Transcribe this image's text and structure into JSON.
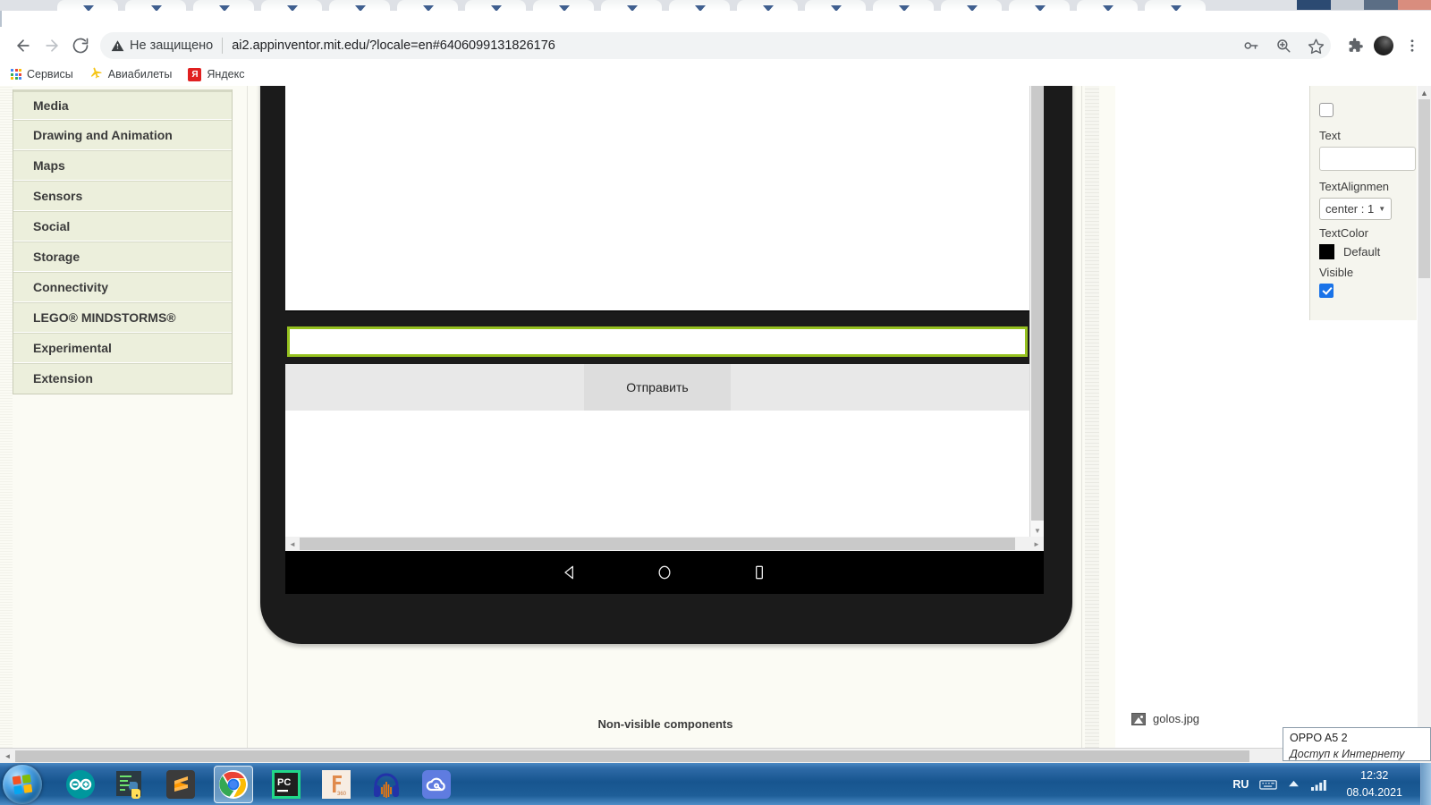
{
  "browser": {
    "nav": {
      "back": "back-arrow",
      "forward": "forward-arrow",
      "reload": "reload"
    },
    "omnibox": {
      "security_warning": "Не защищено",
      "url": "ai2.appinventor.mit.edu/?locale=en#6406099131826176"
    },
    "toolbar_icons": [
      "key-icon",
      "zoom-icon",
      "star-icon",
      "extensions-icon",
      "profile-avatar",
      "chrome-menu-icon"
    ],
    "bookmarks": [
      {
        "label": "Сервисы",
        "icon": "apps-grid-icon"
      },
      {
        "label": "Авиабилеты",
        "icon": "plane-icon"
      },
      {
        "label": "Яндекс",
        "icon": "yandex-icon"
      }
    ]
  },
  "palette": {
    "items": [
      {
        "label": "Media"
      },
      {
        "label": "Drawing and Animation"
      },
      {
        "label": "Maps"
      },
      {
        "label": "Sensors"
      },
      {
        "label": "Social"
      },
      {
        "label": "Storage"
      },
      {
        "label": "Connectivity"
      },
      {
        "label": "LEGO® MINDSTORMS®"
      },
      {
        "label": "Experimental"
      },
      {
        "label": "Extension"
      }
    ]
  },
  "viewer": {
    "send_button_label": "Отправить",
    "nonvisible_label": "Non-visible components",
    "selection_color": "#95c11f",
    "android_nav": [
      "back-triangle-icon",
      "home-circle-icon",
      "recents-square-icon"
    ]
  },
  "media": {
    "items": [
      {
        "label": "golos.jpg",
        "icon": "image-file-icon"
      }
    ]
  },
  "properties": {
    "text_label": "Text",
    "text_value": "",
    "textalignment_label": "TextAlignmen",
    "textalignment_value": "center : 1",
    "textcolor_label": "TextColor",
    "textcolor_value": "Default",
    "textcolor_swatch": "#000000",
    "visible_label": "Visible",
    "visible_checked": true
  },
  "network_tooltip": {
    "line1": "OPPO A5  2",
    "line2": "Доступ к Интернету"
  },
  "taskbar": {
    "start": "windows-start-orb",
    "apps": [
      {
        "name": "arduino-ide",
        "active": false
      },
      {
        "name": "python-idle",
        "active": false
      },
      {
        "name": "sublime-text",
        "active": false
      },
      {
        "name": "google-chrome",
        "active": true
      },
      {
        "name": "pycharm",
        "active": false
      },
      {
        "name": "fusion-360",
        "active": false
      },
      {
        "name": "audacity",
        "active": false
      },
      {
        "name": "cloud-app",
        "active": false
      }
    ],
    "tray": {
      "language": "RU",
      "icons": [
        "keyboard-icon",
        "show-hidden-icons-arrow",
        "network-signal-icon"
      ],
      "time": "12:32",
      "date": "08.04.2021"
    }
  }
}
